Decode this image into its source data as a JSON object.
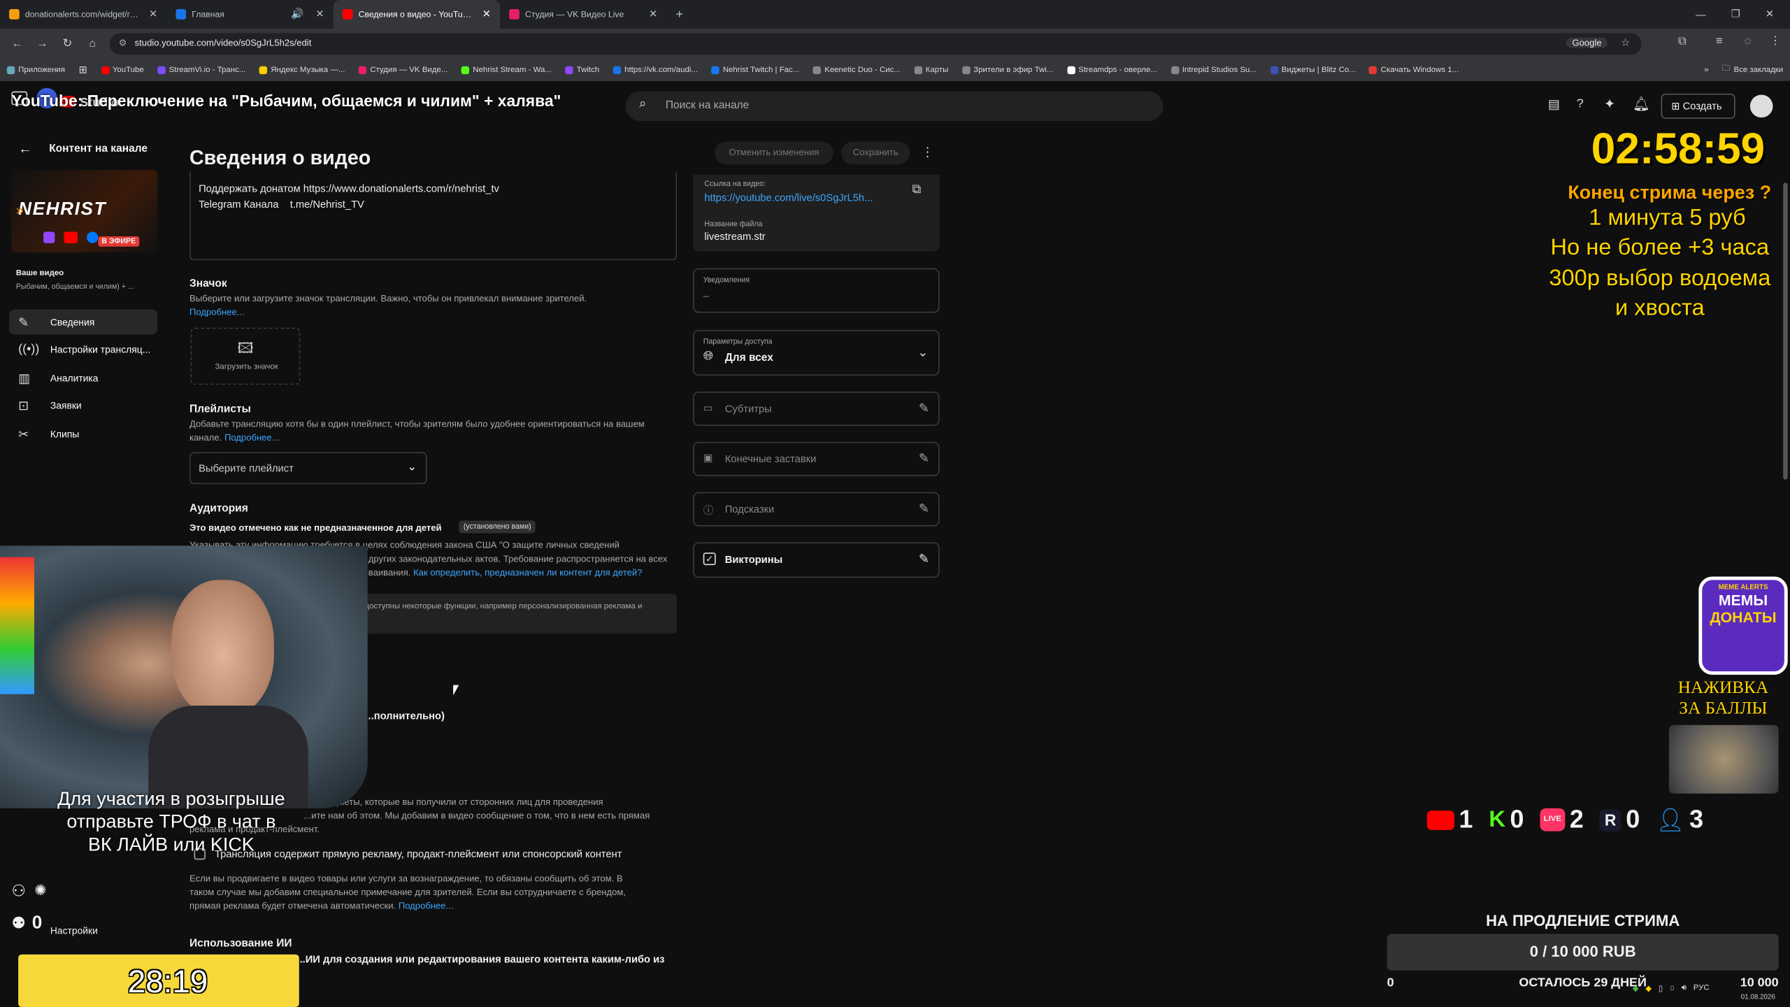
{
  "browser": {
    "tabs": [
      {
        "label": "donationalerts.com/widget/rou",
        "color": "#f59e0b",
        "active": false
      },
      {
        "label": "Главная",
        "color": "#1a73e8",
        "active": false
      },
      {
        "label": "Сведения о видео - YouTube S",
        "color": "#ff0000",
        "active": true
      },
      {
        "label": "Студия — VK Видео Live",
        "color": "#e91e63",
        "active": false
      }
    ],
    "url": "studio.youtube.com/video/s0SgJrL5h2s/edit",
    "search_engine": "Google",
    "bookmarks": [
      "Приложения",
      "YouTube",
      "StreamVi.io - Транс...",
      "Яндекс Музыка —...",
      "Студия — VK Виде...",
      "Nehrist Stream - Wa...",
      "Twitch",
      "https://vk.com/audi...",
      "Nehrist Twitch | Fac...",
      "Keenetic Duo - Сис...",
      "Карты",
      "Зрители в эфир Twi...",
      "Streamdps - оверле...",
      "Intrepid Studios Su...",
      "Виджеты | Blitz Co...",
      "Скачать Windows 1..."
    ],
    "all_bookmarks": "Все закладки"
  },
  "header": {
    "studio_label": "Studio",
    "search_placeholder": "Поиск на канале",
    "create_label": "Создать"
  },
  "overlay_title": "YouTube: Переключение на \"Рыбачим, общаемся и чилим\" + халява\"",
  "sidebar": {
    "back_label": "Контент на канале",
    "channel_name": "NEHRIST",
    "live_badge": "В ЭФИРЕ",
    "your_video_label": "Ваше видео",
    "your_video_title": "Рыбачим, общаемся и чилим) + ...",
    "items": [
      {
        "label": "Сведения",
        "icon": "pencil-icon"
      },
      {
        "label": "Настройки трансляц...",
        "icon": "broadcast-icon"
      },
      {
        "label": "Аналитика",
        "icon": "analytics-icon"
      },
      {
        "label": "Заявки",
        "icon": "requests-icon"
      },
      {
        "label": "Клипы",
        "icon": "scissors-icon"
      }
    ],
    "settings_label": "Настройки"
  },
  "main": {
    "page_title": "Сведения о видео",
    "discard_label": "Отменить изменения",
    "save_label": "Сохранить",
    "description_line1": "Поддержать донатом https://www.donationalerts.com/r/nehrist_tv",
    "description_line2": "Telegram Канала    t.me/Nehrist_TV",
    "thumbnail": {
      "heading": "Значок",
      "text": "Выберите или загрузите значок трансляции. Важно, чтобы он привлекал внимание зрителей.",
      "more": "Подробнее...",
      "upload_label": "Загрузить значок"
    },
    "playlists": {
      "heading": "Плейлисты",
      "text": "Добавьте трансляцию хотя бы в один плейлист, чтобы зрителям было удобнее ориентироваться на вашем канале.",
      "more": "Подробнее...",
      "select_placeholder": "Выберите плейлист"
    },
    "audience": {
      "heading": "Аудитория",
      "status": "Это видео отмечено как не предназначенное для детей",
      "set_by_you": "(установлено вами)",
      "text1": "Указывать эту информацию требуется в целях соблюдения закона США \"О защите личных сведений",
      "text2": "...других законодательных актов. Требование распространяется на всех",
      "text3": "...ваивания.",
      "how_link": "Как определить, предназначен ли контент для детей?",
      "info_box": "...недоступны некоторые функции, например персонализированная реклама и"
    },
    "extra_label": "...полнительно)",
    "promo": {
      "text1": "...енные предметы, которые вы получили от сторонних лиц для проведения",
      "text2": "...ите нам об этом. Мы добавим в видео сообщение о том, что в нем есть прямая",
      "text3": "реклама и продакт-плейсмент.",
      "checkbox_label": "Трансляция содержит прямую рекламу, продакт-плейсмент или спонсорский контент",
      "para1": "Если вы продвигаете в видео товары или услуги за вознаграждение, то обязаны сообщить об этом. В",
      "para2": "таком случае мы добавим специальное примечание для зрителей. Если вы сотрудничаете с брендом,",
      "para3": "прямая реклама будет отмечена автоматически.",
      "more": "Подробнее..."
    },
    "ai": {
      "heading": "Использование ИИ",
      "text": "...ИИ для создания или редактирования вашего контента каким-либо из"
    }
  },
  "right_panel": {
    "link_label": "Ссылка на видео:",
    "link_value": "https://youtube.com/live/s0SgJrL5h...",
    "file_label": "Название файла",
    "file_value": "livestream.str",
    "notifications_label": "Уведомления",
    "notifications_value": "–",
    "access_label": "Параметры доступа",
    "access_value": "Для всех",
    "subtitles_label": "Субтитры",
    "endscreens_label": "Конечные заставки",
    "hints_label": "Подсказки",
    "quizzes_label": "Викторины"
  },
  "stream": {
    "timer": "02:58:59",
    "end_question": "Конец стрима через ?",
    "rate": "1 минута 5 руб",
    "limit": "Но не более +3 часа",
    "choice_line1": "300р выбор водоема",
    "choice_line2": "и хвоста",
    "memes_top": "МЕМЫ",
    "memes_bottom": "ДОНАТЫ",
    "memes_badge": "MEME ALERTS",
    "bait_line1": "НАЖИВКА",
    "bait_line2": "ЗА БАЛЛЫ",
    "viewers": [
      {
        "platform": "youtube",
        "count": "1",
        "color": "#ff0000"
      },
      {
        "platform": "kick",
        "count": "0",
        "color": "#53fc18"
      },
      {
        "platform": "vk-live",
        "count": "2",
        "color": "#ff3366"
      },
      {
        "platform": "rutube",
        "count": "0",
        "color": "#1a1a2e"
      },
      {
        "platform": "total",
        "count": "3",
        "color": "#2196f3"
      }
    ],
    "extend_title": "НА ПРОДЛЕНИЕ СТРИМА",
    "goal_value": "0 / 10 000 RUB",
    "goal_progress": 0,
    "goal_min": "0",
    "goal_remaining": "ОСТАЛОСЬ 29 ДНЕЙ",
    "goal_max": "10 000",
    "giveaway_line1": "Для участия в розыгрыше",
    "giveaway_line2": "отправьте ТРОФ в чат в",
    "giveaway_line3": "ВК ЛАЙВ или KICK",
    "counter_a": "0",
    "bottom_timer": "28:19"
  },
  "taskbar": {
    "lang": "РУС",
    "date": "01.08.2026"
  }
}
